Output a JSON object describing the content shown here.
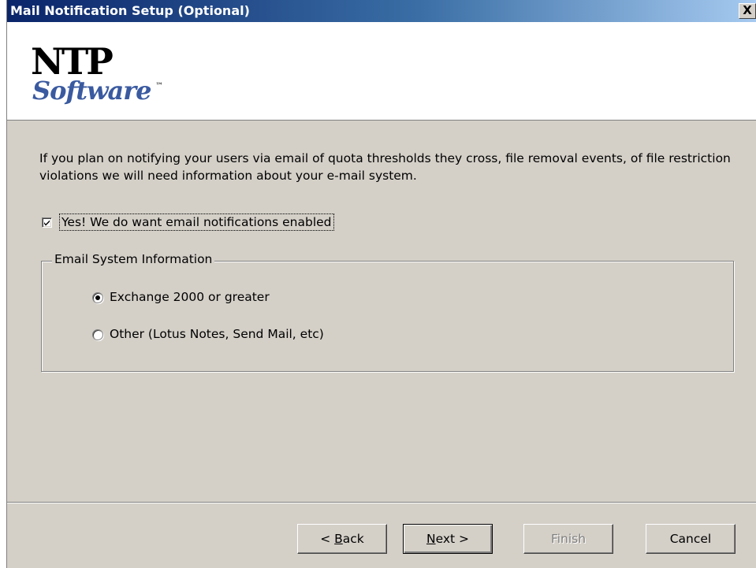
{
  "window": {
    "title": "Mail Notification Setup  (Optional)",
    "close_label": "X"
  },
  "logo": {
    "top_text": "NTP",
    "bottom_text": "Software",
    "trademark": "™"
  },
  "intro": {
    "text": "If you plan on notifying your users via email of quota thresholds they cross, file removal events, of file restriction violations we will need information about your e-mail system."
  },
  "enable_checkbox": {
    "label": "Yes! We do want email notifications enabled",
    "checked": true
  },
  "email_group": {
    "title": "Email System Information",
    "options": [
      {
        "label": "Exchange 2000 or greater",
        "selected": true
      },
      {
        "label": "Other (Lotus Notes, Send Mail, etc)",
        "selected": false
      }
    ]
  },
  "buttons": {
    "back_prefix": "< ",
    "back_underlined": "B",
    "back_rest": "ack",
    "next_underlined": "N",
    "next_rest": "ext >",
    "finish": "Finish",
    "cancel": "Cancel"
  },
  "colors": {
    "title_start": "#0a246a",
    "title_end": "#a6caf0",
    "dialog_bg": "#d4d0c8",
    "logo_blue": "#3a5aa0"
  }
}
